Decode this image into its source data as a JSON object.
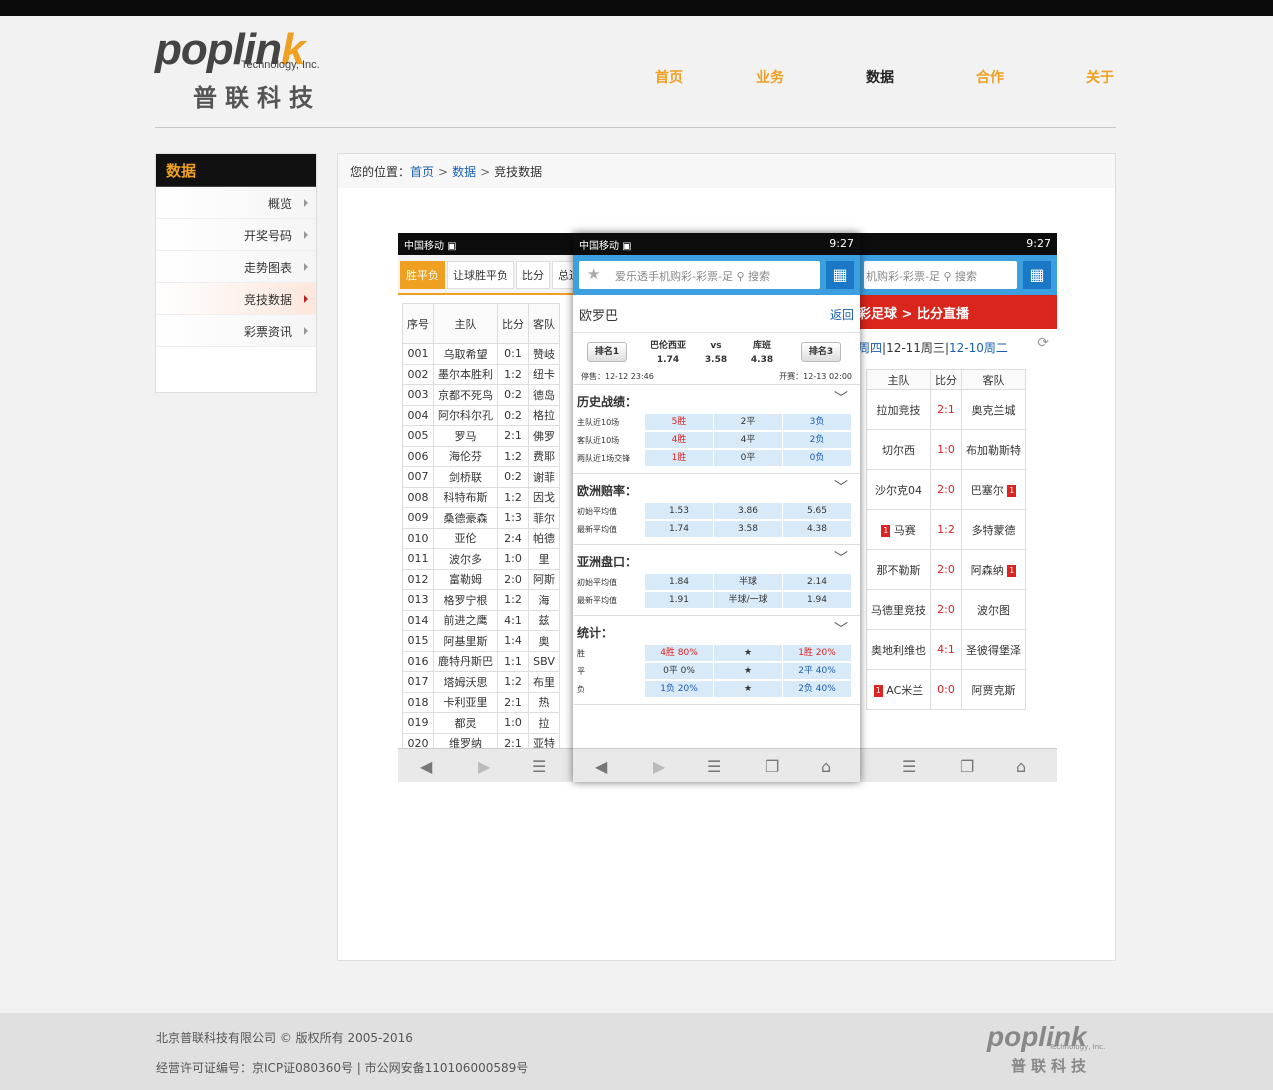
{
  "brand": {
    "word_main": "poplin",
    "word_k": "k",
    "sub": "Technology, Inc.",
    "cn": "普联科技"
  },
  "nav": [
    {
      "label": "首页"
    },
    {
      "label": "业务"
    },
    {
      "label": "数据"
    },
    {
      "label": "合作"
    },
    {
      "label": "关于"
    }
  ],
  "sidebar": {
    "title": "数据",
    "items": [
      {
        "label": "概览"
      },
      {
        "label": "开奖号码"
      },
      {
        "label": "走势图表"
      },
      {
        "label": "竞技数据"
      },
      {
        "label": "彩票资讯"
      }
    ]
  },
  "breadcrumb": {
    "prefix": "您的位置：",
    "home": "首页",
    "section": "数据",
    "current": "竞技数据",
    "sep": ">"
  },
  "phone_status": {
    "carrier": "中国移动",
    "time": "9:27"
  },
  "phone1": {
    "tabs": [
      "胜平负",
      "让球胜平负",
      "比分",
      "总进"
    ],
    "headers": [
      "序号",
      "主队",
      "比分",
      "客队"
    ],
    "rows": [
      [
        "001",
        "乌取希望",
        "0:1",
        "赞岐"
      ],
      [
        "002",
        "墨尔本胜利",
        "1:2",
        "纽卡"
      ],
      [
        "003",
        "京都不死鸟",
        "0:2",
        "德岛"
      ],
      [
        "004",
        "阿尔科尔孔",
        "0:2",
        "格拉"
      ],
      [
        "005",
        "罗马",
        "2:1",
        "佛罗"
      ],
      [
        "006",
        "海伦芬",
        "1:2",
        "费耶"
      ],
      [
        "007",
        "剑桥联",
        "0:2",
        "谢菲"
      ],
      [
        "008",
        "科特布斯",
        "1:2",
        "因戈"
      ],
      [
        "009",
        "桑德豪森",
        "1:3",
        "菲尔"
      ],
      [
        "010",
        "亚伦",
        "2:4",
        "帕德"
      ],
      [
        "011",
        "波尔多",
        "1:0",
        "里"
      ],
      [
        "012",
        "富勒姆",
        "2:0",
        "阿斯"
      ],
      [
        "013",
        "格罗宁根",
        "1:2",
        "海"
      ],
      [
        "014",
        "前进之鹰",
        "4:1",
        "兹"
      ],
      [
        "015",
        "阿基里斯",
        "1:4",
        "奥"
      ],
      [
        "016",
        "鹿特丹斯巴",
        "1:1",
        "SBV"
      ],
      [
        "017",
        "塔姆沃思",
        "1:2",
        "布里"
      ],
      [
        "018",
        "卡利亚里",
        "2:1",
        "热"
      ],
      [
        "019",
        "都灵",
        "1:0",
        "拉"
      ],
      [
        "020",
        "维罗纳",
        "2:1",
        "亚特"
      ]
    ]
  },
  "phone2": {
    "search_placeholder": "爱乐透手机购彩-彩票-足",
    "search_label": "搜索",
    "title": "欧罗巴",
    "back": "返回",
    "match": {
      "rank_left": "排名1",
      "rank_right": "排名3",
      "home": "巴伦西亚",
      "home_odds": "1.74",
      "vs": "vs",
      "vs_odds": "3.58",
      "away": "库班",
      "away_odds": "4.38",
      "stop": "停售：12-12 23:46",
      "open": "开赛：12-13 02:00"
    },
    "sections": [
      {
        "title": "历史战绩：",
        "rows": [
          {
            "label": "主队近10场",
            "a": "5胜",
            "b": "2平",
            "c": "3负"
          },
          {
            "label": "客队近10场",
            "a": "4胜",
            "b": "4平",
            "c": "2负"
          },
          {
            "label": "两队近1场交锋",
            "a": "1胜",
            "b": "0平",
            "c": "0负"
          }
        ]
      },
      {
        "title": "欧洲赔率：",
        "rows": [
          {
            "label": "初始平均值",
            "a": "1.53",
            "b": "3.86",
            "c": "5.65"
          },
          {
            "label": "最新平均值",
            "a": "1.74",
            "b": "3.58",
            "c": "4.38"
          }
        ]
      },
      {
        "title": "亚洲盘口：",
        "rows": [
          {
            "label": "初始平均值",
            "a": "1.84",
            "b": "半球",
            "c": "2.14"
          },
          {
            "label": "最新平均值",
            "a": "1.91",
            "b": "半球/一球",
            "c": "1.94"
          }
        ]
      },
      {
        "title": "统计：",
        "rows": [
          {
            "label": "胜",
            "a": "4胜 80%",
            "b": "★",
            "c": "1胜 20%"
          },
          {
            "label": "平",
            "a": "0平 0%",
            "b": "★",
            "c": "2平 40%"
          },
          {
            "label": "负",
            "a": "1负 20%",
            "b": "★",
            "c": "2负 40%"
          }
        ]
      }
    ]
  },
  "phone3": {
    "search_placeholder": "机购彩-彩票-足",
    "search_label": "搜索",
    "banner": "彩足球 > 比分直播",
    "dates": {
      "d1": "周四",
      "sep1": "|",
      "d2": "12-11周三",
      "sep2": "|",
      "d3": "12-10周二"
    },
    "headers": [
      "主队",
      "比分",
      "客队"
    ],
    "rows": [
      {
        "home": "拉加竞技",
        "score": "2:1",
        "away": "奥克兰城",
        "hc": "",
        "ac": ""
      },
      {
        "home": "切尔西",
        "score": "1:0",
        "away": "布加勒斯特",
        "hc": "",
        "ac": ""
      },
      {
        "home": "沙尔克04",
        "score": "2:0",
        "away": "巴塞尔",
        "hc": "",
        "ac": "1"
      },
      {
        "home": "马赛",
        "score": "1:2",
        "away": "多特蒙德",
        "hc": "1",
        "ac": ""
      },
      {
        "home": "那不勒斯",
        "score": "2:0",
        "away": "阿森纳",
        "hc": "",
        "ac": "1"
      },
      {
        "home": "马德里竞技",
        "score": "2:0",
        "away": "波尔图",
        "hc": "",
        "ac": ""
      },
      {
        "home": "奥地利维也",
        "score": "4:1",
        "away": "圣彼得堡泽",
        "hc": "",
        "ac": ""
      },
      {
        "home": "AC米兰",
        "score": "0:0",
        "away": "阿贾克斯",
        "hc": "1",
        "ac": ""
      }
    ]
  },
  "footer": {
    "copyright": "北京普联科技有限公司 © 版权所有 2005-2016",
    "license": "经营许可证编号：京ICP证080360号 | 市公网安备110106000589号"
  }
}
